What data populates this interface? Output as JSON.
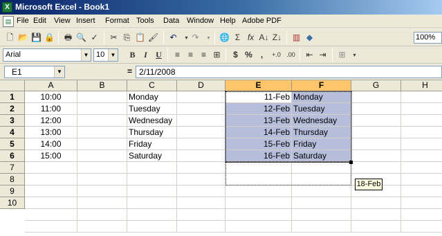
{
  "window": {
    "title": "Microsoft Excel - Book1"
  },
  "menu": [
    "File",
    "Edit",
    "View",
    "Insert",
    "Format",
    "Tools",
    "Data",
    "Window",
    "Help",
    "Adobe PDF"
  ],
  "toolbar": {
    "zoom": "100%"
  },
  "format_toolbar": {
    "font": "Arial",
    "size": "10",
    "bold": "B",
    "italic": "I",
    "underline": "U",
    "currency": "$",
    "percent": "%",
    "comma": ","
  },
  "formula_bar": {
    "name_box": "E1",
    "equals": "=",
    "formula": "2/11/2008"
  },
  "columns": [
    "A",
    "B",
    "C",
    "D",
    "E",
    "F",
    "G",
    "H"
  ],
  "rows": [
    "1",
    "2",
    "3",
    "4",
    "5",
    "6",
    "7",
    "8",
    "9",
    "10"
  ],
  "col_A": [
    "10:00",
    "11:00",
    "12:00",
    "13:00",
    "14:00",
    "15:00"
  ],
  "col_C": [
    "Monday",
    "Tuesday",
    "Wednesday",
    "Thursday",
    "Friday",
    "Saturday"
  ],
  "col_E": [
    "11-Feb",
    "12-Feb",
    "13-Feb",
    "14-Feb",
    "15-Feb",
    "16-Feb"
  ],
  "col_F": [
    "Monday",
    "Tuesday",
    "Wednesday",
    "Thursday",
    "Friday",
    "Saturday"
  ],
  "autofill_tooltip": "18-Feb",
  "colors": {
    "selection": "#b6bedc",
    "active_header": "#ffc56b",
    "chrome": "#ece9d8"
  }
}
